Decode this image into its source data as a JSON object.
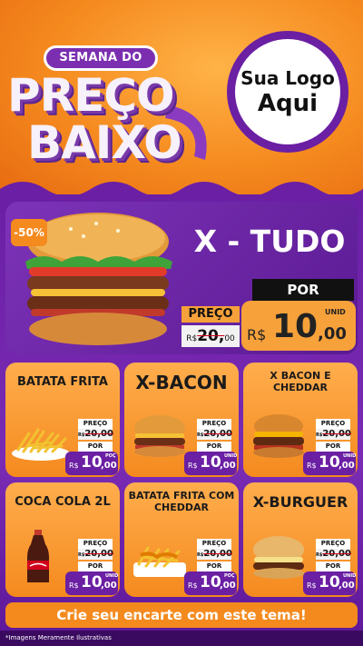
{
  "header": {
    "badge": "SEMANA DO",
    "title_line1": "PREÇO",
    "title_line2": "BAIXO",
    "logo_line1": "Sua Logo",
    "logo_line2": "Aqui"
  },
  "hero": {
    "discount": "-50%",
    "name": "X - TUDO",
    "preco_label": "PREÇO",
    "old_price": "20,",
    "old_price_cents": "00",
    "old_currency": "R$",
    "por_label": "POR",
    "currency": "R$",
    "price_int": "10",
    "price_dec": ",00",
    "unit": "UNID"
  },
  "products": [
    {
      "name": "BATATA FRITA",
      "image_icon": "fries-icon",
      "preco_label": "PREÇO",
      "old_price": "20,00",
      "old_currency": "R$",
      "por_label": "POR",
      "currency": "R$",
      "price_int": "10",
      "price_dec": ",00",
      "unit": "POÇ"
    },
    {
      "name": "X-BACON",
      "image_icon": "burger-icon",
      "preco_label": "PREÇO",
      "old_price": "20,00",
      "old_currency": "R$",
      "por_label": "POR",
      "currency": "R$",
      "price_int": "10",
      "price_dec": ",00",
      "unit": "UNID"
    },
    {
      "name": "X BACON E CHEDDAR",
      "image_icon": "cheeseburger-icon",
      "preco_label": "PREÇO",
      "old_price": "20,00",
      "old_currency": "R$",
      "por_label": "POR",
      "currency": "R$",
      "price_int": "10",
      "price_dec": ",00",
      "unit": "UNID"
    },
    {
      "name": "COCA COLA 2L",
      "image_icon": "soda-bottle-icon",
      "preco_label": "PREÇO",
      "old_price": "20,00",
      "old_currency": "R$",
      "por_label": "POR",
      "currency": "R$",
      "price_int": "10",
      "price_dec": ",00",
      "unit": "UNID"
    },
    {
      "name": "BATATA FRITA COM CHEDDAR",
      "image_icon": "cheddar-fries-icon",
      "preco_label": "PREÇO",
      "old_price": "20,00",
      "old_currency": "R$",
      "por_label": "POR",
      "currency": "R$",
      "price_int": "10",
      "price_dec": ",00",
      "unit": "POÇ"
    },
    {
      "name": "X-BURGUER",
      "image_icon": "burger-icon",
      "preco_label": "PREÇO",
      "old_price": "20,00",
      "old_currency": "R$",
      "por_label": "POR",
      "currency": "R$",
      "price_int": "10",
      "price_dec": ",00",
      "unit": "UNID"
    }
  ],
  "cta": "Crie seu encarte com este tema!",
  "disclaimer": "*Imagens Meramente Ilustrativas",
  "colors": {
    "orange": "#f48a1e",
    "purple": "#6b1fa3",
    "dark_purple": "#3a0a60",
    "strike_red": "#d0021b"
  }
}
